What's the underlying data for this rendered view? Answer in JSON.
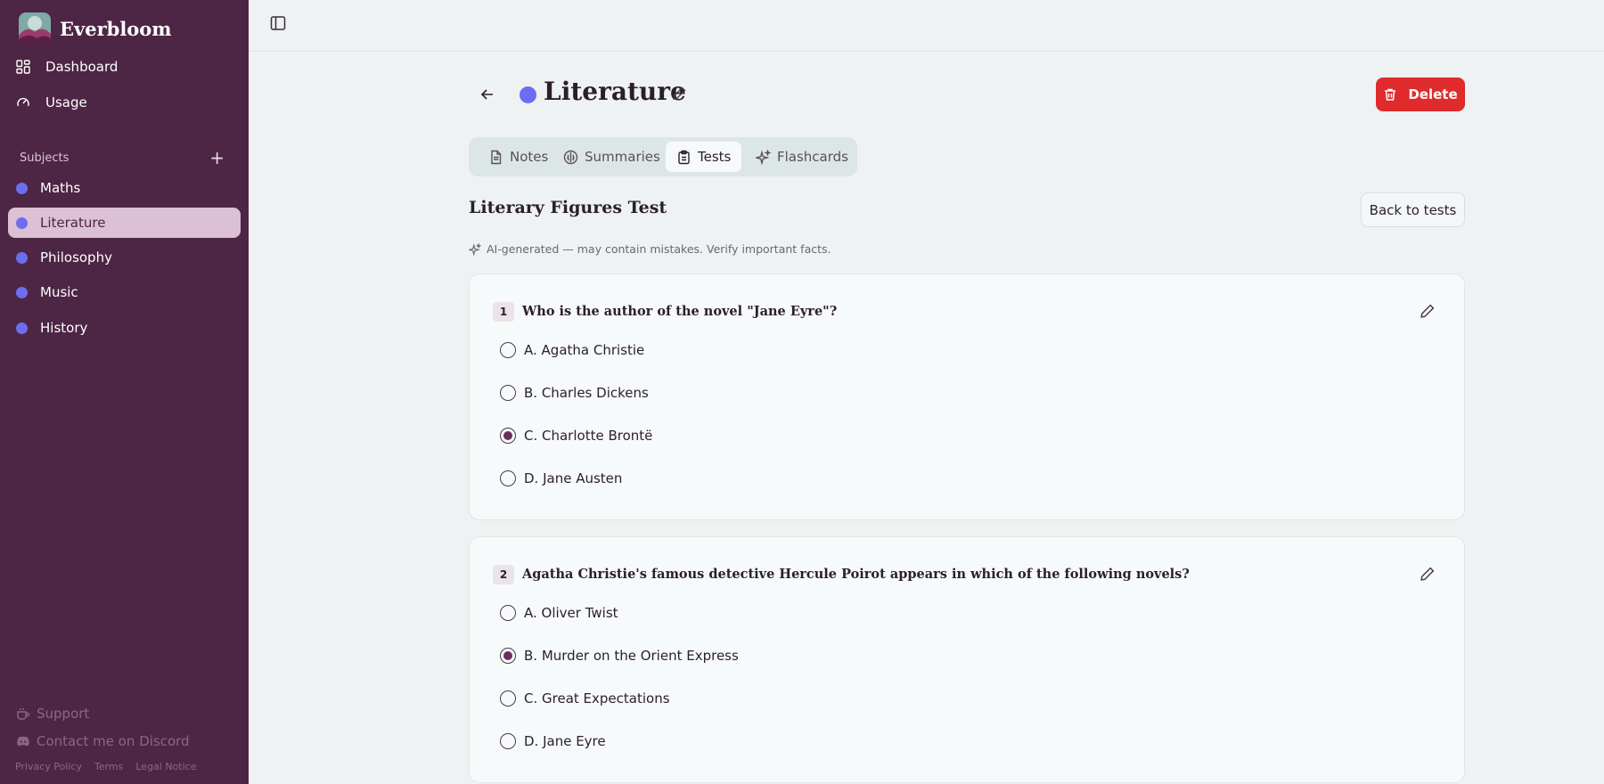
{
  "app": {
    "name": "Everbloom"
  },
  "nav": [
    {
      "label": "Dashboard",
      "icon": "dashboard-icon"
    },
    {
      "label": "Usage",
      "icon": "gauge-icon"
    }
  ],
  "subjects": {
    "heading": "Subjects",
    "add_icon": "plus-icon",
    "items": [
      {
        "label": "Maths",
        "active": false
      },
      {
        "label": "Literature",
        "active": true
      },
      {
        "label": "Philosophy",
        "active": false
      },
      {
        "label": "Music",
        "active": false
      },
      {
        "label": "History",
        "active": false
      }
    ],
    "dot_color": "#6b6ef0"
  },
  "footer": {
    "support": "Support",
    "discord": "Contact me on Discord",
    "legal": [
      "Privacy Policy",
      "Terms",
      "Legal Notice"
    ]
  },
  "header": {
    "title": "Literature",
    "delete_label": "Delete",
    "accent": "#df2b2b"
  },
  "tabs": [
    {
      "label": "Notes",
      "icon": "document-icon"
    },
    {
      "label": "Summaries",
      "icon": "brain-icon"
    },
    {
      "label": "Tests",
      "icon": "clipboard-icon"
    },
    {
      "label": "Flashcards",
      "icon": "sparkles-icon"
    }
  ],
  "active_tab": "Tests",
  "test": {
    "title": "Literary Figures Test",
    "back_label": "Back to tests",
    "ai_note": "AI-generated — may contain mistakes. Verify important facts."
  },
  "questions": [
    {
      "number": "1",
      "text": "Who is the author of the novel \"Jane Eyre\"?",
      "options": [
        "A. Agatha Christie",
        "B. Charles Dickens",
        "C. Charlotte Brontë",
        "D. Jane Austen"
      ],
      "selected": 2
    },
    {
      "number": "2",
      "text": "Agatha Christie's famous detective Hercule Poirot appears in which of the following novels?",
      "options": [
        "A. Oliver Twist",
        "B. Murder on the Orient Express",
        "C. Great Expectations",
        "D. Jane Eyre"
      ],
      "selected": 1
    }
  ]
}
